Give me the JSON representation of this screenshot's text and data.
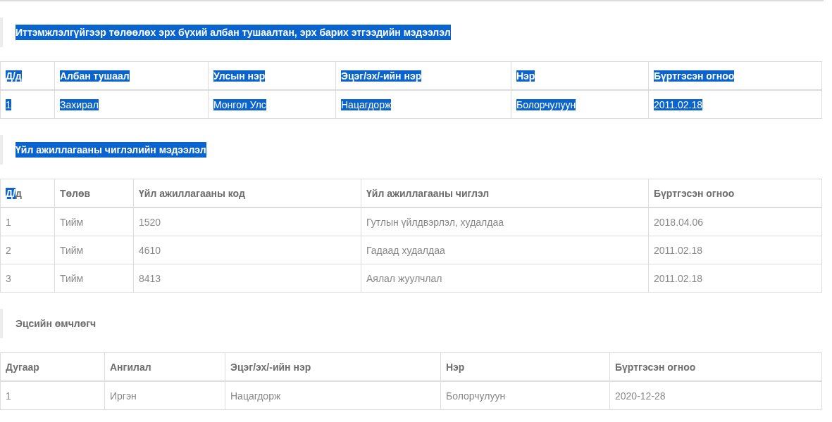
{
  "sections": [
    {
      "title": "Иттэмжлэлгүйгээр төлөөлөх эрх бүхий албан тушаалтан, эрх барих этгээдийн мэдээлэл",
      "title_highlighted": true,
      "table": {
        "highlighted": true,
        "columns": [
          {
            "label": "Д/д"
          },
          {
            "label": "Албан тушаал"
          },
          {
            "label": "Улсын нэр"
          },
          {
            "label": "Эцэг/эх/-ийн нэр"
          },
          {
            "label": "Нэр"
          },
          {
            "label": "Бүртгэсэн огноо"
          }
        ],
        "rows": [
          [
            "1",
            "Захирал",
            "Монгол Улс",
            "Нацагдорж",
            "Болорчулуун",
            "2011.02.18"
          ]
        ]
      }
    },
    {
      "title": "Үйл ажиллагааны чиглэлийн мэдээлэл",
      "title_highlighted": true,
      "table": {
        "highlighted": false,
        "columns": [
          {
            "segments": [
              {
                "text": "Д/",
                "highlighted": true
              },
              {
                "text": "д",
                "highlighted": false
              }
            ]
          },
          {
            "label": "Төлөв"
          },
          {
            "label": "Үйл ажиллагааны код"
          },
          {
            "label": "Үйл ажиллагааны чиглэл"
          },
          {
            "label": "Бүртгэсэн огноо"
          }
        ],
        "rows": [
          [
            "1",
            "Тийм",
            "1520",
            "Гутлын үйлдвэрлэл, худалдаа",
            "2018.04.06"
          ],
          [
            "2",
            "Тийм",
            "4610",
            "Гадаад худалдаа",
            "2011.02.18"
          ],
          [
            "3",
            "Тийм",
            "8413",
            "Аялал жуулчлал",
            "2011.02.18"
          ]
        ]
      }
    },
    {
      "title": "Эцсийн өмчлөгч",
      "title_highlighted": false,
      "table": {
        "highlighted": false,
        "columns": [
          {
            "label": "Дугаар"
          },
          {
            "label": "Ангилал"
          },
          {
            "label": "Эцэг/эх/-ийн нэр"
          },
          {
            "label": "Нэр"
          },
          {
            "label": "Бүртгэсэн огноо"
          }
        ],
        "rows": [
          [
            "1",
            "Иргэн",
            "Нацагдорж",
            "Болорчулуун",
            "2020-12-28"
          ]
        ]
      }
    }
  ]
}
